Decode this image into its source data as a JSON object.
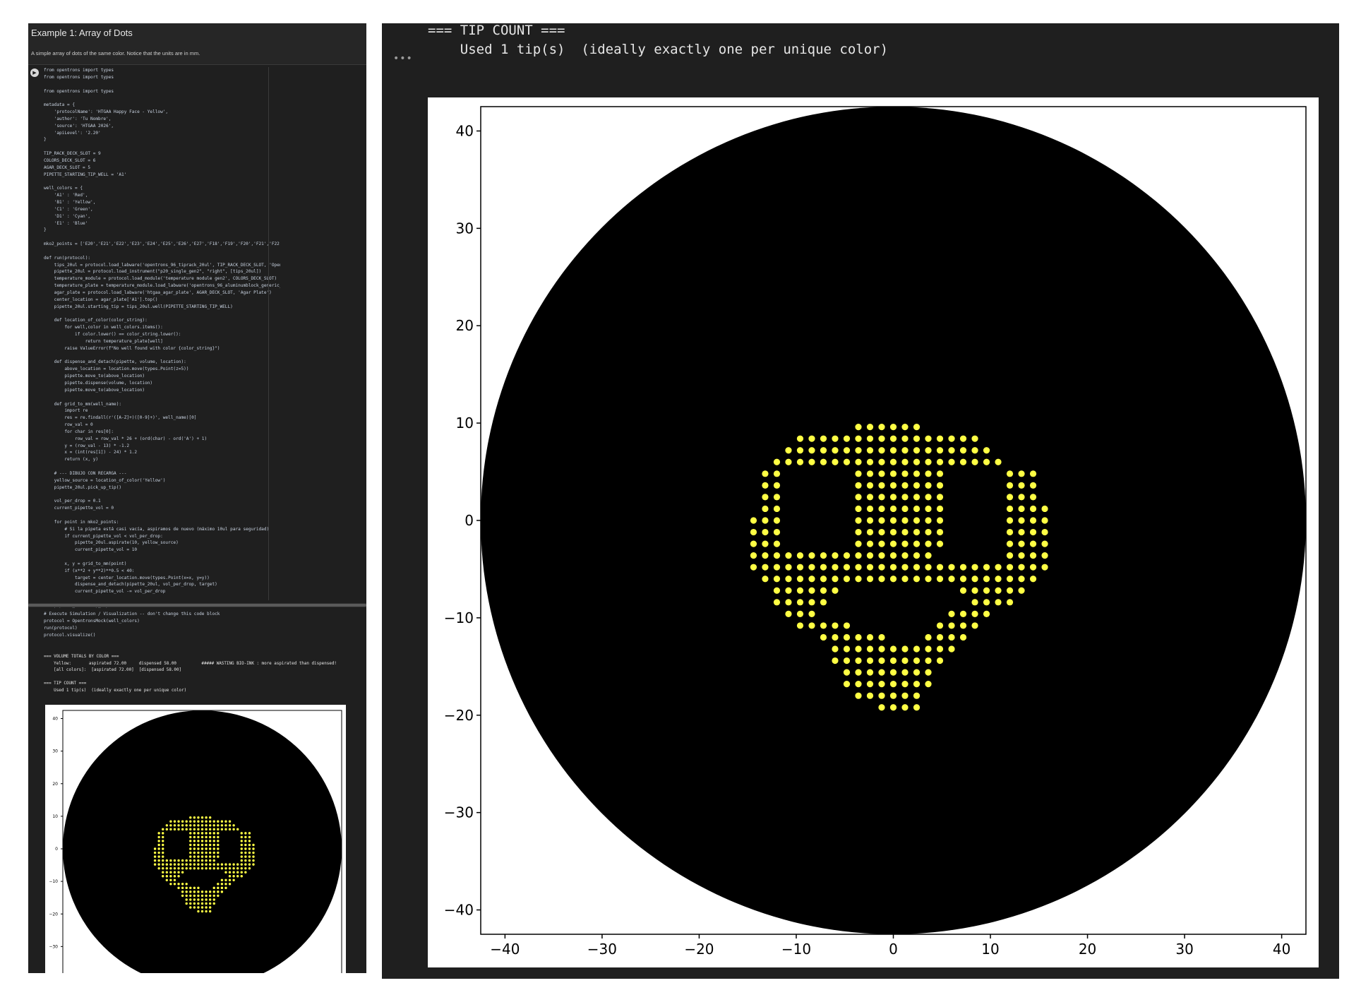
{
  "notebook": {
    "title": "Example 1: Array of Dots",
    "subtitle": "A simple array of dots of the same color. Notice that the units are in mm.",
    "run_icon": "play-icon",
    "code_lines": [
      "from opentrons import types",
      "from opentrons import types",
      "",
      "from opentrons import types",
      "",
      "metadata = {",
      "    'protocolName': 'HTGAA Happy Face - Yellow',",
      "    'author': 'Tu Nombre',",
      "    'source': 'HTGAA 2026',",
      "    'apiLevel': '2.20'",
      "}",
      "",
      "TIP_RACK_DECK_SLOT = 9",
      "COLORS_DECK_SLOT = 6",
      "AGAR_DECK_SLOT = 5",
      "PIPETTE_STARTING_TIP_WELL = 'A1'",
      "",
      "well_colors = {",
      "    'A1' : 'Red',",
      "    'B1' : 'Yellow',",
      "    'C1' : 'Green',",
      "    'D1' : 'Cyan',",
      "    'E1' : 'Blue'",
      "}",
      "",
      "mko2_points = ['E20','E21','E22','E23','E24','E25','E26','E27','F18','F19','F20','F21','F22','F23','F24','F25','F26",
      "",
      "def run(protocol):",
      "    tips_20ul = protocol.load_labware('opentrons_96_tiprack_20ul', TIP_RACK_DECK_SLOT, 'Opentrons 20ul Tips')",
      "    pipette_20ul = protocol.load_instrument(\"p20_single_gen2\", \"right\", [tips_20ul])",
      "    temperature_module = protocol.load_module('temperature module gen2', COLORS_DECK_SLOT)",
      "    temperature_plate = temperature_module.load_labware('opentrons_96_aluminumblock_generic_pcr_strip_200ul', 'Cold",
      "    agar_plate = protocol.load_labware('htgaa_agar_plate', AGAR_DECK_SLOT, 'Agar Plate')",
      "    center_location = agar_plate['A1'].top()",
      "    pipette_20ul.starting_tip = tips_20ul.well(PIPETTE_STARTING_TIP_WELL)",
      "",
      "    def location_of_color(color_string):",
      "        for well,color in well_colors.items():",
      "            if color.lower() == color_string.lower():",
      "                return temperature_plate[well]",
      "        raise ValueError(f\"No well found with color {color_string}\")",
      "",
      "    def dispense_and_detach(pipette, volume, location):",
      "        above_location = location.move(types.Point(z=5))",
      "        pipette.move_to(above_location)",
      "        pipette.dispense(volume, location)",
      "        pipette.move_to(above_location)",
      "",
      "    def grid_to_mm(well_name):",
      "        import re",
      "        res = re.findall(r'([A-Z]+)([0-9]+)', well_name)[0]",
      "        row_val = 0",
      "        for char in res[0]:",
      "            row_val = row_val * 26 + (ord(char) - ord('A') + 1)",
      "        y = (row_val - 13) * -1.2",
      "        x = (int(res[1]) - 24) * 1.2",
      "        return (x, y)",
      "",
      "    # --- DIBUJO CON RECARGA ---",
      "    yellow_source = location_of_color('Yellow')",
      "    pipette_20ul.pick_up_tip()",
      "",
      "    vol_per_drop = 0.1",
      "    current_pipette_vol = 0",
      "",
      "    for point in mko2_points:",
      "        # Si la pipeta está casi vacía, aspiramos de nuevo (máximo 10ul para seguridad)",
      "        if current_pipette_vol < vol_per_drop:",
      "            pipette_20ul.aspirate(10, yellow_source)",
      "            current_pipette_vol = 10",
      "",
      "        x, y = grid_to_mm(point)",
      "        if (x**2 + y**2)**0.5 < 40:",
      "            target = center_location.move(types.Point(x=x, y=y))",
      "            dispense_and_detach(pipette_20ul, vol_per_drop, target)",
      "            current_pipette_vol -= vol_per_drop",
      "",
      "    pipette_20ul.drop_tip()"
    ],
    "exec_lines": [
      "# Execute Simulation / Visualization -- don't change this code block",
      "protocol = OpentronsMock(well_colors)",
      "run(protocol)",
      "protocol.visualize()"
    ],
    "output_lines": [
      "=== VOLUME TOTALS BY COLOR ===",
      "    Yellow:       aspirated 72.00     dispensed 58.00          ##### WASTING BIO-INK : more aspirated than dispensed!",
      "    [all colors]:  [aspirated 72.00]  [dispensed 58.00]",
      "",
      "=== TIP COUNT ===",
      "    Used 1 tip(s)  (ideally exactly one per unique color)"
    ]
  },
  "right_output": {
    "lines": [
      "=== TIP COUNT ===",
      "    Used 1 tip(s)  (ideally exactly one per unique color)"
    ],
    "menu_icon": "more-horizontal-icon",
    "menu_label": "•••"
  },
  "colors": {
    "background": "#1f1f1f",
    "dot": "#ffff44",
    "plate": "#000000",
    "axis": "#000000"
  },
  "chart_data": {
    "type": "scatter",
    "title": "",
    "xlabel": "",
    "ylabel": "",
    "xlim": [
      -42.5,
      42.5
    ],
    "ylim": [
      -42.5,
      42.5
    ],
    "xticks": [
      -40,
      -30,
      -20,
      -10,
      0,
      10,
      20,
      30,
      40
    ],
    "yticks": [
      -40,
      -30,
      -20,
      -10,
      0,
      10,
      20,
      30,
      40
    ],
    "grid": false,
    "circle": {
      "center": [
        0,
        0
      ],
      "radius": 42.5,
      "color": "#000000"
    },
    "dot_color": "#ffff44",
    "dot_grid": {
      "step": 1.2,
      "col_offset": 24,
      "row_offset": 13,
      "row_start": 5,
      "row_end": 29
    },
    "dot_rows": [
      {
        "row": 5,
        "segments": [
          [
            21,
            26
          ]
        ]
      },
      {
        "row": 6,
        "segments": [
          [
            16,
            31
          ]
        ]
      },
      {
        "row": 7,
        "segments": [
          [
            15,
            32
          ]
        ]
      },
      {
        "row": 8,
        "segments": [
          [
            14,
            20
          ],
          [
            21,
            28
          ],
          [
            29,
            33
          ]
        ]
      },
      {
        "row": 9,
        "segments": [
          [
            13,
            14
          ],
          [
            21,
            28
          ],
          [
            34,
            36
          ]
        ]
      },
      {
        "row": 10,
        "segments": [
          [
            13,
            14
          ],
          [
            21,
            28
          ],
          [
            34,
            36
          ]
        ]
      },
      {
        "row": 11,
        "segments": [
          [
            13,
            14
          ],
          [
            21,
            28
          ],
          [
            34,
            36
          ]
        ]
      },
      {
        "row": 12,
        "segments": [
          [
            13,
            14
          ],
          [
            21,
            28
          ],
          [
            34,
            37
          ]
        ]
      },
      {
        "row": 13,
        "segments": [
          [
            12,
            14
          ],
          [
            21,
            28
          ],
          [
            34,
            37
          ]
        ]
      },
      {
        "row": 14,
        "segments": [
          [
            12,
            14
          ],
          [
            21,
            28
          ],
          [
            34,
            37
          ]
        ]
      },
      {
        "row": 15,
        "segments": [
          [
            12,
            14
          ],
          [
            21,
            28
          ],
          [
            34,
            37
          ]
        ]
      },
      {
        "row": 16,
        "segments": [
          [
            12,
            15
          ],
          [
            16,
            27
          ],
          [
            34,
            37
          ]
        ]
      },
      {
        "row": 17,
        "segments": [
          [
            12,
            37
          ]
        ]
      },
      {
        "row": 18,
        "segments": [
          [
            13,
            36
          ]
        ]
      },
      {
        "row": 19,
        "segments": [
          [
            14,
            19
          ],
          [
            30,
            35
          ]
        ]
      },
      {
        "row": 20,
        "segments": [
          [
            14,
            18
          ],
          [
            31,
            34
          ]
        ]
      },
      {
        "row": 21,
        "segments": [
          [
            15,
            17
          ],
          [
            29,
            32
          ]
        ]
      },
      {
        "row": 22,
        "segments": [
          [
            16,
            20
          ],
          [
            28,
            31
          ]
        ]
      },
      {
        "row": 23,
        "segments": [
          [
            18,
            23
          ],
          [
            27,
            30
          ]
        ]
      },
      {
        "row": 24,
        "segments": [
          [
            19,
            29
          ]
        ]
      },
      {
        "row": 25,
        "segments": [
          [
            19,
            28
          ]
        ]
      },
      {
        "row": 26,
        "segments": [
          [
            20,
            27
          ]
        ]
      },
      {
        "row": 27,
        "segments": [
          [
            20,
            27
          ]
        ]
      },
      {
        "row": 28,
        "segments": [
          [
            21,
            26
          ]
        ]
      },
      {
        "row": 29,
        "segments": [
          [
            23,
            26
          ]
        ]
      }
    ]
  }
}
